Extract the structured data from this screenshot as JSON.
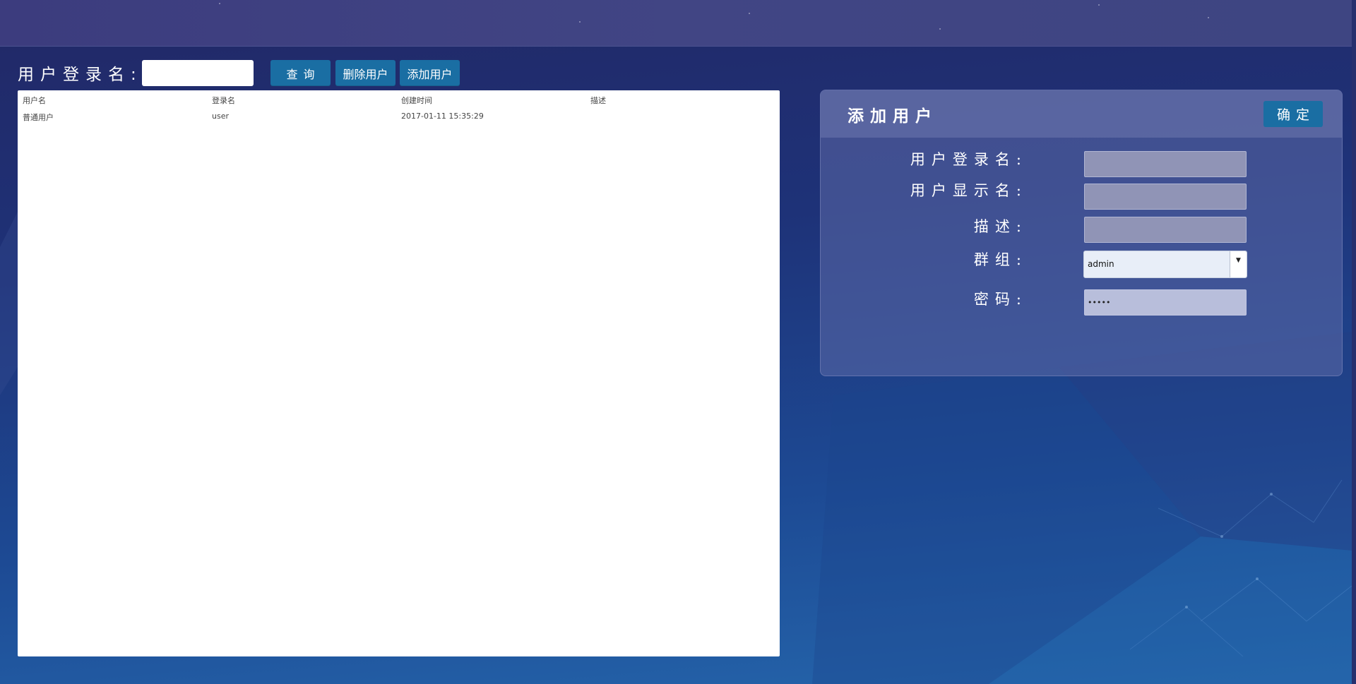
{
  "search": {
    "label": "用户登录名:",
    "value": "",
    "query_button": "查询",
    "delete_button": "删除用户",
    "add_button": "添加用户"
  },
  "table": {
    "columns": [
      "用户名",
      "登录名",
      "创建时间",
      "描述"
    ],
    "rows": [
      [
        "普通用户",
        "user",
        "2017-01-11 15:35:29",
        ""
      ]
    ]
  },
  "form": {
    "title": "添加用户",
    "confirm_button": "确定",
    "login_name_label": "用户登录名:",
    "login_name_value": "",
    "display_name_label": "用户显示名:",
    "display_name_value": "",
    "description_label": "描述:",
    "description_value": "",
    "group_label": "群组:",
    "group_value": "admin",
    "password_label": "密码:",
    "password_value": "•••••"
  },
  "colors": {
    "button": "#1a6ea3",
    "background_top": "#222866",
    "background_bottom": "#2566ac",
    "panel": "#5c6aa8"
  }
}
